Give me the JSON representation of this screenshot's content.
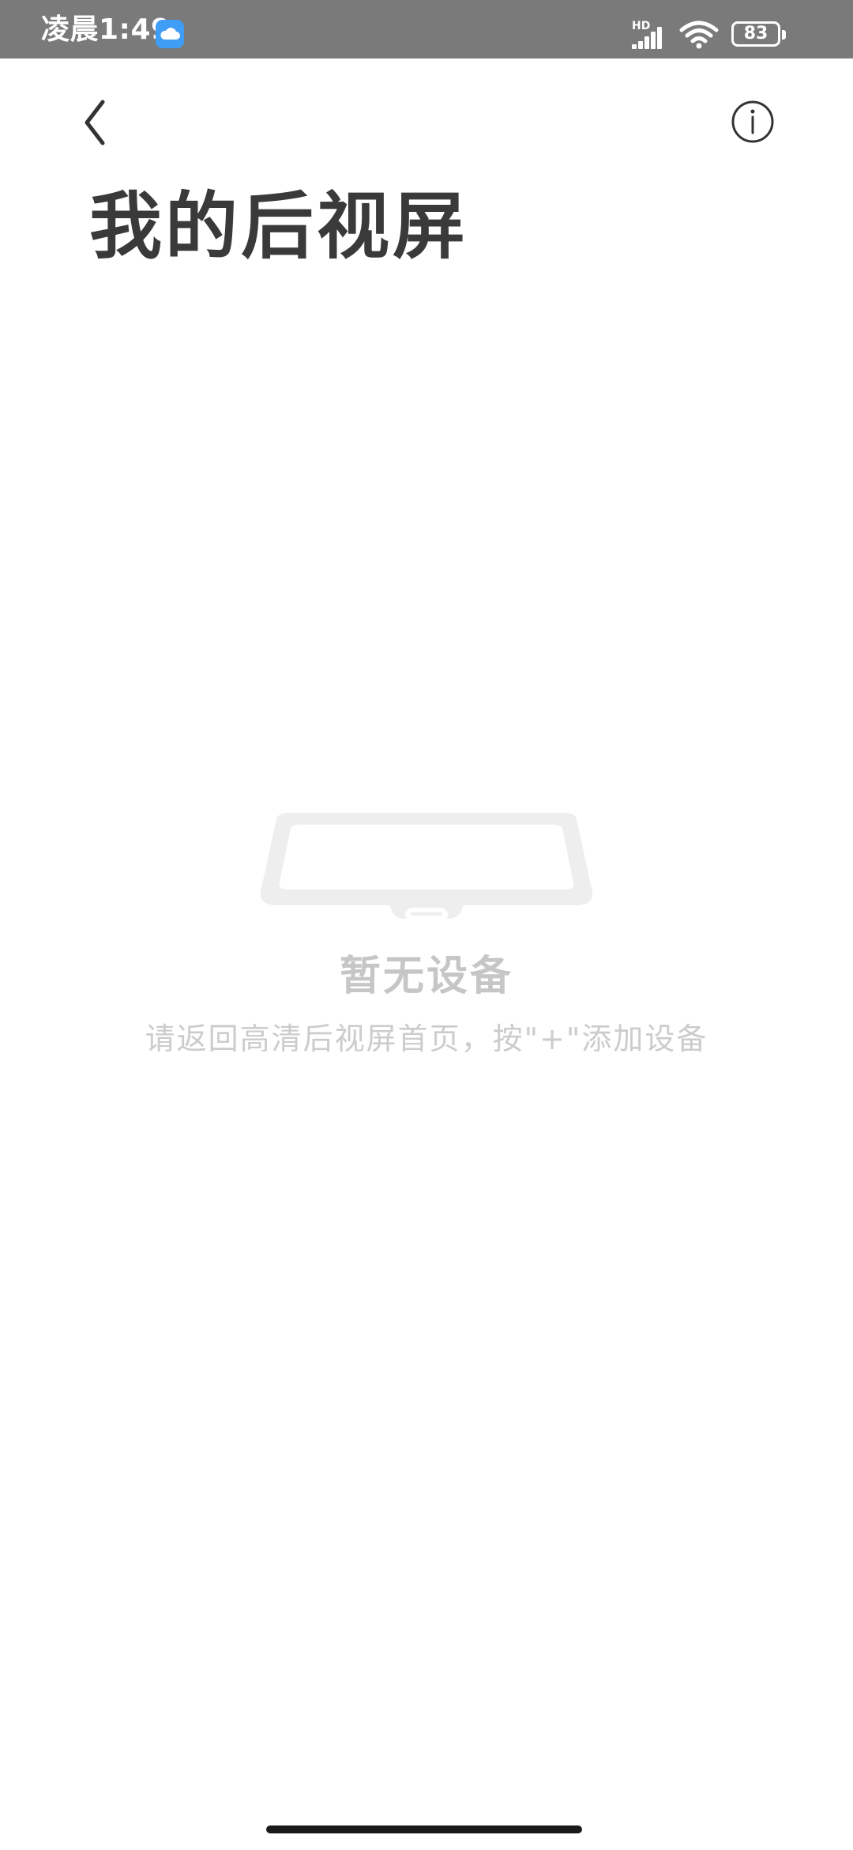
{
  "status_bar": {
    "time": "凌晨1:49",
    "network_label": "HD",
    "battery_level": "83",
    "icons": [
      "cloud-app-icon",
      "signal-icon",
      "wifi-icon",
      "battery-icon"
    ]
  },
  "header": {
    "back_icon": "chevron-left-icon",
    "info_icon": "info-icon",
    "title": "我的后视屏"
  },
  "empty_state": {
    "illustration": "rearview-mirror-icon",
    "title": "暂无设备",
    "hint": "请返回高清后视屏首页，按\"+\"添加设备"
  },
  "colors": {
    "status_bar_bg": "#7a7a7a",
    "title": "#3a3a3a",
    "empty_text": "#c6c6c6",
    "illustration": "#eeeeee"
  }
}
